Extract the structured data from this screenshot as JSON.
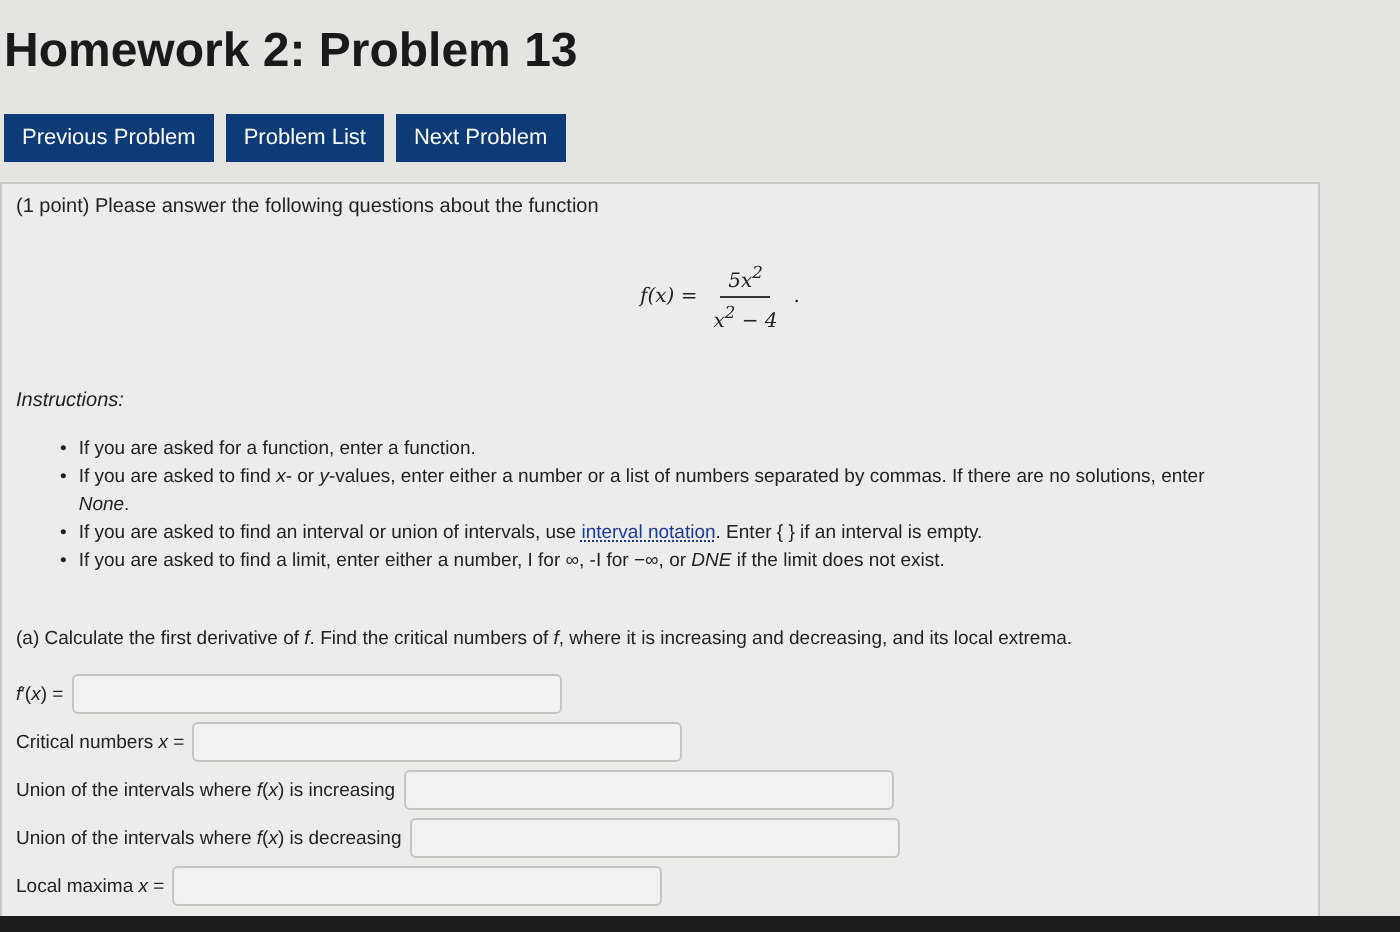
{
  "title": "Homework 2: Problem 13",
  "nav_buttons": [
    "Previous Problem",
    "Problem List",
    "Next Problem"
  ],
  "problem": {
    "intro": "(1 point) Please answer the following questions about the function",
    "formula": {
      "lhs": "f(x) =",
      "numerator": "5x$^{2}$",
      "denominator": "x$^{2}$ − 4",
      "trail": "."
    },
    "instructions_heading": "Instructions:",
    "instructions": [
      {
        "marker": "•",
        "segments": [
          {
            "kind": "text",
            "text": "If you are asked for a function, enter a function."
          }
        ]
      },
      {
        "marker": "•",
        "segments": [
          {
            "kind": "text",
            "text": "If you are asked to find *x*- or *y*-values, enter either a number or a list of numbers separated by commas. If there are no solutions, enter *None*."
          }
        ]
      },
      {
        "marker": "•",
        "segments": [
          {
            "kind": "text",
            "text": "If you are asked to find an interval or union of intervals, use"
          },
          {
            "kind": "link",
            "text": "interval notation"
          },
          {
            "kind": "text",
            "text": ". Enter { } if an interval is empty."
          }
        ]
      },
      {
        "marker": "•",
        "segments": [
          {
            "kind": "text",
            "text": "If you are asked to find a limit, enter either a number, I for ∞, -I for −∞, or *DNE* if the limit does not exist."
          }
        ]
      }
    ],
    "part_a": "(a) Calculate the first derivative of *f*. Find the critical numbers of *f*, where it is increasing and decreasing, and its local extrema.",
    "answers": [
      {
        "label": "*f*′(*x*) ="
      },
      {
        "label": "Critical numbers *x* ="
      },
      {
        "label": "Union of the intervals where *f*(*x*) is increasing"
      },
      {
        "label": "Union of the intervals where *f*(*x*) is decreasing"
      },
      {
        "label": "Local maxima *x* ="
      }
    ]
  }
}
